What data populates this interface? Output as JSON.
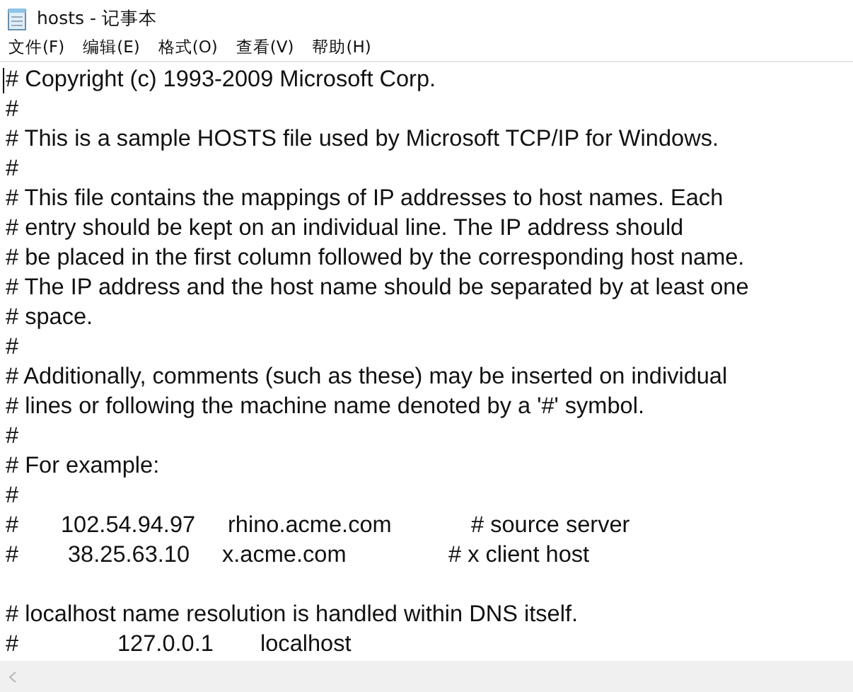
{
  "window": {
    "title": "hosts - 记事本"
  },
  "menu": [
    "文件(F)",
    "编辑(E)",
    "格式(O)",
    "查看(V)",
    "帮助(H)"
  ],
  "lines": [
    {
      "kind": "text",
      "text": "# Copyright (c) 1993-2009 Microsoft Corp."
    },
    {
      "kind": "text",
      "text": "#"
    },
    {
      "kind": "text",
      "text": "# This is a sample HOSTS file used by Microsoft TCP/IP for Windows."
    },
    {
      "kind": "text",
      "text": "#"
    },
    {
      "kind": "text",
      "text": "# This file contains the mappings of IP addresses to host names. Each"
    },
    {
      "kind": "text",
      "text": "# entry should be kept on an individual line. The IP address should"
    },
    {
      "kind": "text",
      "text": "# be placed in the first column followed by the corresponding host name."
    },
    {
      "kind": "text",
      "text": "# The IP address and the host name should be separated by at least one"
    },
    {
      "kind": "text",
      "text": "# space."
    },
    {
      "kind": "text",
      "text": "#"
    },
    {
      "kind": "text",
      "text": "# Additionally, comments (such as these) may be inserted on individual"
    },
    {
      "kind": "text",
      "text": "# lines or following the machine name denoted by a '#' symbol."
    },
    {
      "kind": "text",
      "text": "#"
    },
    {
      "kind": "text",
      "text": "# For example:"
    },
    {
      "kind": "text",
      "text": "#"
    },
    {
      "kind": "fields",
      "fields": [
        "#",
        "102.54.94.97",
        "rhino.acme.com",
        "# source server"
      ]
    },
    {
      "kind": "fields",
      "fields": [
        "#",
        "38.25.63.10",
        "x.acme.com",
        "# x client host"
      ]
    },
    {
      "kind": "blank"
    },
    {
      "kind": "text",
      "text": "# localhost name resolution is handled within DNS itself."
    },
    {
      "kind": "fields",
      "fields": [
        "#",
        "127.0.0.1",
        "localhost"
      ]
    }
  ]
}
